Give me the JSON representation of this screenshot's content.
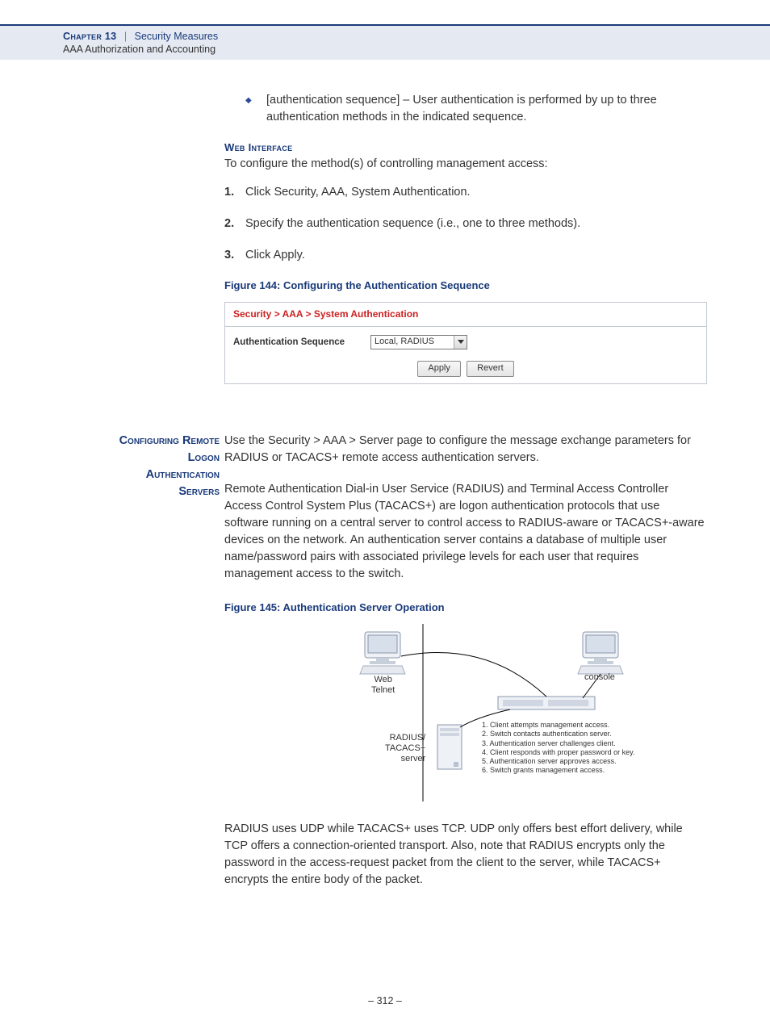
{
  "header": {
    "chapter_label": "Chapter 13",
    "separator": "|",
    "chapter_title": "Security Measures",
    "subtitle": "AAA Authorization and Accounting"
  },
  "intro_bullet": "[authentication sequence] – User authentication is performed by up to three authentication methods in the indicated sequence.",
  "web_interface": {
    "heading": "Web Interface",
    "lead": "To configure the method(s) of controlling management access:",
    "steps": [
      "Click Security, AAA, System Authentication.",
      "Specify the authentication sequence (i.e., one to three methods).",
      "Click Apply."
    ]
  },
  "figure144": {
    "caption": "Figure 144:  Configuring the Authentication Sequence",
    "breadcrumb": "Security > AAA > System Authentication",
    "field_label": "Authentication Sequence",
    "field_value": "Local, RADIUS",
    "btn_apply": "Apply",
    "btn_revert": "Revert"
  },
  "section2": {
    "heading": "Configuring Remote Logon Authentication Servers",
    "para1": "Use the Security > AAA > Server page to configure the message exchange parameters for RADIUS or TACACS+ remote access authentication servers.",
    "para2": "Remote Authentication Dial-in User Service (RADIUS) and Terminal Access Controller Access Control System Plus (TACACS+) are logon authentication protocols that use software running on a central server to control access to RADIUS-aware or TACACS+-aware devices on the network. An authentication server contains a database of multiple user name/password pairs with associated privilege levels for each user that requires management access to the switch."
  },
  "figure145": {
    "caption": "Figure 145:  Authentication Server Operation",
    "label_web": "Web\nTelnet",
    "label_console": "console",
    "label_server": "RADIUS/\nTACACS+\nserver",
    "steps": [
      "1. Client attempts management access.",
      "2. Switch contacts authentication server.",
      "3. Authentication server challenges client.",
      "4. Client responds with proper password or key.",
      "5. Authentication server approves access.",
      "6. Switch grants management access."
    ]
  },
  "closing_para": "RADIUS uses UDP while TACACS+ uses TCP. UDP only offers best effort delivery, while TCP offers a connection-oriented transport. Also, note that RADIUS encrypts only the password in the access-request packet from the client to the server, while TACACS+ encrypts the entire body of the packet.",
  "page_number": "–  312  –"
}
